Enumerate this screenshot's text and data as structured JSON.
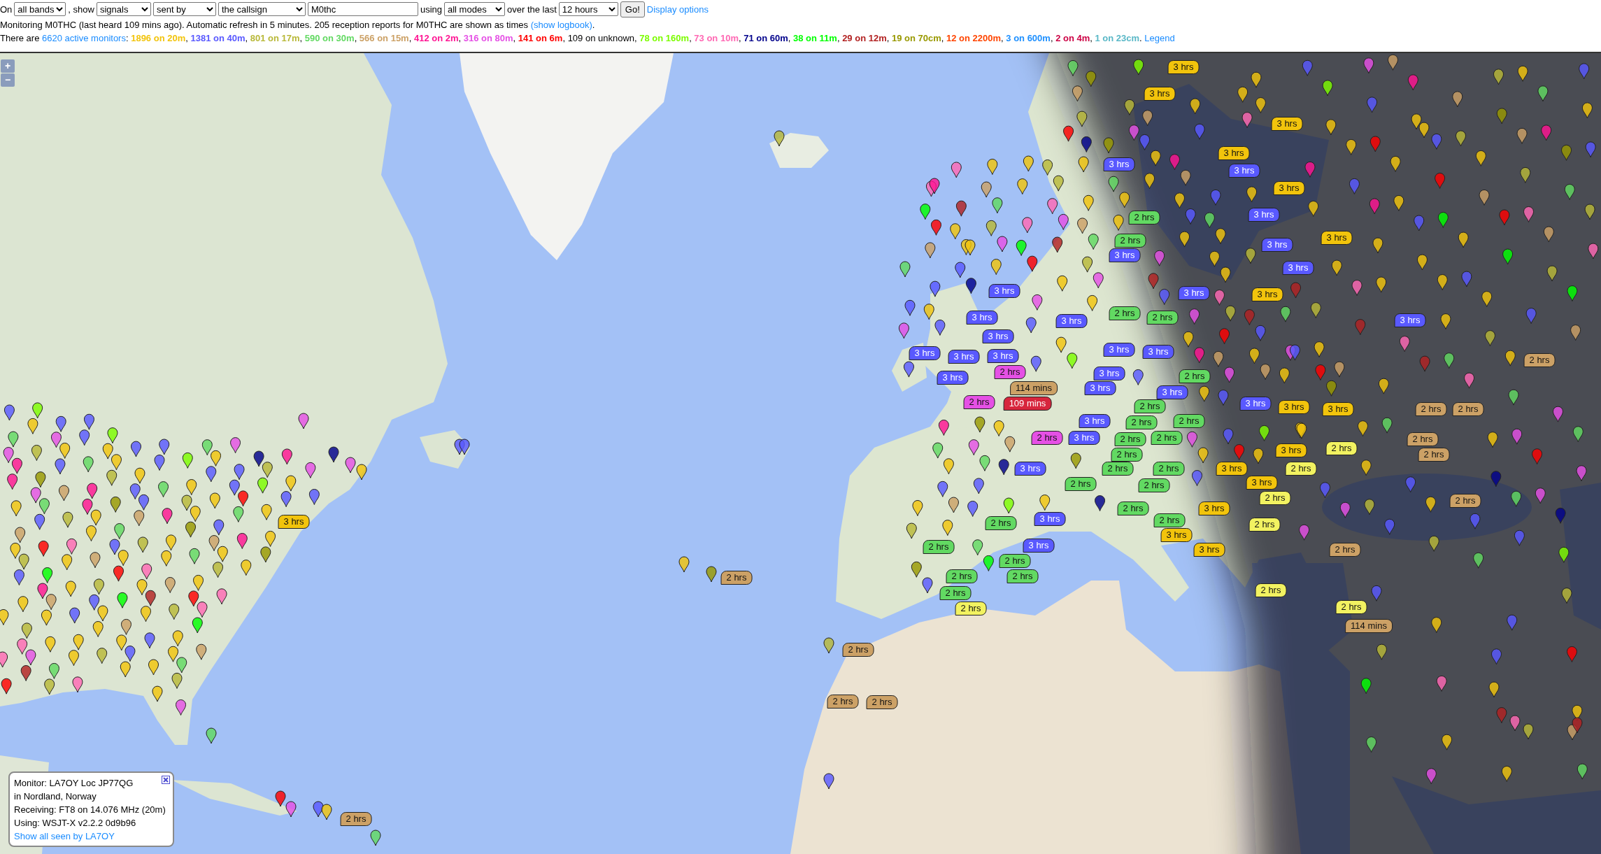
{
  "controls": {
    "on_label": "On",
    "band": "all bands",
    "show_label": ", show",
    "what": "signals",
    "direction": "sent by",
    "target": "the callsign",
    "callsign": "M0thc",
    "using_label": "using",
    "mode": "all modes",
    "period_label": "over the last",
    "period": "12 hours",
    "go": "Go!",
    "options_link": "Display options"
  },
  "status": {
    "text": "Monitoring M0THC (last heard 109 mins ago). Automatic refresh in 5 minutes. 205 reception reports for M0THC are shown as times",
    "link": "(show logbook)",
    "end": "."
  },
  "monitors": {
    "prefix": "There are",
    "link": "6620 active monitors",
    "colon": ":",
    "bands": [
      {
        "kind": "band",
        "text": "1896 on 20m",
        "color": "#f2c40c"
      },
      {
        "kind": "band",
        "text": "1381 on 40m",
        "color": "#5959ff"
      },
      {
        "kind": "band",
        "text": "801 on 17m",
        "color": "#b8b838"
      },
      {
        "kind": "band",
        "text": "590 on 30m",
        "color": "#62d962"
      },
      {
        "kind": "band",
        "text": "566 on 15m",
        "color": "#cca166"
      },
      {
        "kind": "band",
        "text": "412 on 2m",
        "color": "#ff1493"
      },
      {
        "kind": "band",
        "text": "316 on 80m",
        "color": "#e550e5"
      },
      {
        "kind": "band",
        "text": "141 on 6m",
        "color": "#ff0000"
      },
      {
        "kind": "plain",
        "text": "109 on unknown"
      },
      {
        "kind": "band",
        "text": "78 on 160m",
        "color": "#7cfc00"
      },
      {
        "kind": "band",
        "text": "73 on 10m",
        "color": "#ff69b4"
      },
      {
        "kind": "band",
        "text": "71 on 60m",
        "color": "#00008b"
      },
      {
        "kind": "band",
        "text": "38 on 11m",
        "color": "#00ff00"
      },
      {
        "kind": "band",
        "text": "29 on 12m",
        "color": "#b22222"
      },
      {
        "kind": "band",
        "text": "19 on 70cm",
        "color": "#999900"
      },
      {
        "kind": "band",
        "text": "12 on 2200m",
        "color": "#ff4500"
      },
      {
        "kind": "band",
        "text": "3 on 600m",
        "color": "#1e90ff"
      },
      {
        "kind": "band",
        "text": "2 on 4m",
        "color": "#cc0044"
      },
      {
        "kind": "band",
        "text": "1 on 23cm",
        "color": "#5ab8c7"
      }
    ],
    "separator": ",",
    "end": ".",
    "legend": "Legend"
  },
  "map": {
    "zoom_in": "+",
    "zoom_out": "−",
    "report_markers": [
      {
        "text": "3 hrs",
        "color": "#f2c40c"
      },
      {
        "text": "3 hrs",
        "color": "#f2c40c"
      },
      {
        "text": "3 hrs",
        "color": "#f2c40c"
      },
      {
        "text": "3 hrs",
        "color": "#f2c40c"
      },
      {
        "text": "3 hrs",
        "color": "#5959ff"
      },
      {
        "text": "3 hrs",
        "color": "#5959ff"
      },
      {
        "text": "3 hrs",
        "color": "#f2c40c"
      },
      {
        "text": "2 hrs",
        "color": "#62d962"
      },
      {
        "text": "3 hrs",
        "color": "#5959ff"
      },
      {
        "text": "2 hrs",
        "color": "#62d962"
      },
      {
        "text": "3 hrs",
        "color": "#5959ff"
      },
      {
        "text": "3 hrs",
        "color": "#f2c40c"
      },
      {
        "text": "3 hrs",
        "color": "#5959ff"
      },
      {
        "text": "3 hrs",
        "color": "#5959ff"
      },
      {
        "text": "3 hrs",
        "color": "#5959ff"
      },
      {
        "text": "3 hrs",
        "color": "#5959ff"
      },
      {
        "text": "3 hrs",
        "color": "#f2c40c"
      },
      {
        "text": "3 hrs",
        "color": "#5959ff"
      },
      {
        "text": "3 hrs",
        "color": "#5959ff"
      },
      {
        "text": "2 hrs",
        "color": "#62d962"
      },
      {
        "text": "2 hrs",
        "color": "#62d962"
      },
      {
        "text": "3 hrs",
        "color": "#5959ff"
      },
      {
        "text": "3 hrs",
        "color": "#5959ff"
      },
      {
        "text": "3 hrs",
        "color": "#5959ff"
      },
      {
        "text": "3 hrs",
        "color": "#5959ff"
      },
      {
        "text": "3 hrs",
        "color": "#5959ff"
      },
      {
        "text": "3 hrs",
        "color": "#5959ff"
      },
      {
        "text": "3 hrs",
        "color": "#5959ff"
      },
      {
        "text": "2 hrs",
        "color": "#cca166"
      },
      {
        "text": "3 hrs",
        "color": "#5959ff"
      },
      {
        "text": "2 hrs",
        "color": "#e550e5"
      },
      {
        "text": "3 hrs",
        "color": "#5959ff"
      },
      {
        "text": "2 hrs",
        "color": "#62d962"
      },
      {
        "text": "114 mins",
        "color": "#cca166"
      },
      {
        "text": "3 hrs",
        "color": "#5959ff"
      },
      {
        "text": "3 hrs",
        "color": "#5959ff"
      },
      {
        "text": "2 hrs",
        "color": "#e550e5"
      },
      {
        "text": "109 mins",
        "color": "#d7263d"
      },
      {
        "text": "2 hrs",
        "color": "#62d962"
      },
      {
        "text": "3 hrs",
        "color": "#5959ff"
      },
      {
        "text": "3 hrs",
        "color": "#f2c40c"
      },
      {
        "text": "3 hrs",
        "color": "#f2c40c"
      },
      {
        "text": "2 hrs",
        "color": "#cca166"
      },
      {
        "text": "2 hrs",
        "color": "#cca166"
      },
      {
        "text": "3 hrs",
        "color": "#5959ff"
      },
      {
        "text": "2 hrs",
        "color": "#62d962"
      },
      {
        "text": "2 hrs",
        "color": "#62d962"
      },
      {
        "text": "2 hrs",
        "color": "#e550e5"
      },
      {
        "text": "3 hrs",
        "color": "#5959ff"
      },
      {
        "text": "2 hrs",
        "color": "#62d962"
      },
      {
        "text": "2 hrs",
        "color": "#62d962"
      },
      {
        "text": "2 hrs",
        "color": "#cca166"
      },
      {
        "text": "2 hrs",
        "color": "#62d962"
      },
      {
        "text": "3 hrs",
        "color": "#f2c40c"
      },
      {
        "text": "2 hrs",
        "color": "#f2f261"
      },
      {
        "text": "2 hrs",
        "color": "#cca166"
      },
      {
        "text": "3 hrs",
        "color": "#5959ff"
      },
      {
        "text": "2 hrs",
        "color": "#62d962"
      },
      {
        "text": "2 hrs",
        "color": "#62d962"
      },
      {
        "text": "3 hrs",
        "color": "#f2c40c"
      },
      {
        "text": "2 hrs",
        "color": "#f2f261"
      },
      {
        "text": "2 hrs",
        "color": "#62d962"
      },
      {
        "text": "2 hrs",
        "color": "#62d962"
      },
      {
        "text": "3 hrs",
        "color": "#f2c40c"
      },
      {
        "text": "2 hrs",
        "color": "#f2f261"
      },
      {
        "text": "2 hrs",
        "color": "#cca166"
      },
      {
        "text": "2 hrs",
        "color": "#62d962"
      },
      {
        "text": "3 hrs",
        "color": "#f2c40c"
      },
      {
        "text": "3 hrs",
        "color": "#f2c40c"
      },
      {
        "text": "2 hrs",
        "color": "#62d962"
      },
      {
        "text": "3 hrs",
        "color": "#5959ff"
      },
      {
        "text": "2 hrs",
        "color": "#62d962"
      },
      {
        "text": "2 hrs",
        "color": "#f2f261"
      },
      {
        "text": "3 hrs",
        "color": "#f2c40c"
      },
      {
        "text": "2 hrs",
        "color": "#62d962"
      },
      {
        "text": "3 hrs",
        "color": "#5959ff"
      },
      {
        "text": "3 hrs",
        "color": "#f2c40c"
      },
      {
        "text": "2 hrs",
        "color": "#cca166"
      },
      {
        "text": "2 hrs",
        "color": "#62d962"
      },
      {
        "text": "2 hrs",
        "color": "#cca166"
      },
      {
        "text": "2 hrs",
        "color": "#62d962"
      },
      {
        "text": "2 hrs",
        "color": "#62d962"
      },
      {
        "text": "2 hrs",
        "color": "#62d962"
      },
      {
        "text": "2 hrs",
        "color": "#f2f261"
      },
      {
        "text": "2 hrs",
        "color": "#f2f261"
      },
      {
        "text": "2 hrs",
        "color": "#f2f261"
      },
      {
        "text": "114 mins",
        "color": "#cca166"
      },
      {
        "text": "2 hrs",
        "color": "#cca166"
      },
      {
        "text": "2 hrs",
        "color": "#cca166"
      },
      {
        "text": "2 hrs",
        "color": "#cca166"
      },
      {
        "text": "2 hrs",
        "color": "#cca166"
      }
    ],
    "popup": {
      "lines": [
        "Monitor: LA7OY Loc JP77QG",
        "in Nordland, Norway",
        "Receiving: FT8 on 14.076 MHz (20m)",
        "Using: WSJT-X v2.2.2 0d9b96"
      ],
      "link": "Show all seen by LA7OY"
    }
  }
}
